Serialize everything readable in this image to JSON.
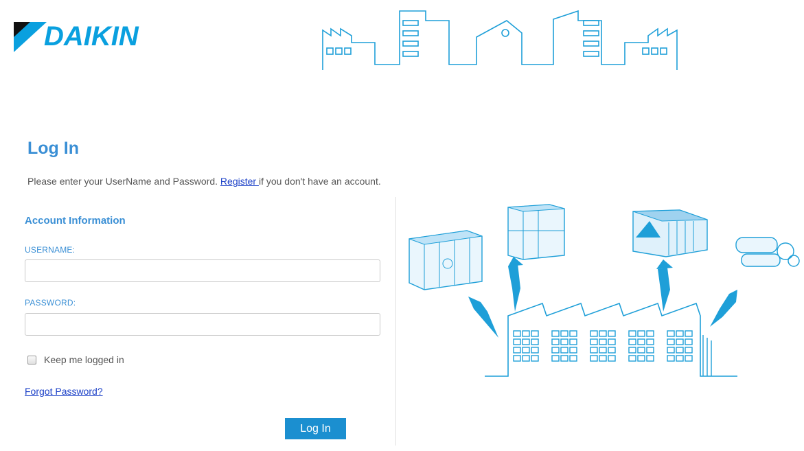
{
  "brand": {
    "name": "DAIKIN",
    "color": "#0aa0df"
  },
  "header": {
    "skyline_icon": "city-skyline-illustration"
  },
  "page": {
    "title": "Log In",
    "intro_text": "Please enter your UserName and Password. ",
    "register_link": "Register ",
    "intro_suffix": "if you don't have an account."
  },
  "form": {
    "section_title": "Account Information",
    "username_label": "USERNAME:",
    "username_value": "",
    "password_label": "PASSWORD:",
    "password_value": "",
    "remember_label": "Keep me logged in",
    "remember_checked": false,
    "forgot_link": "Forgot Password?",
    "submit_label": "Log In"
  },
  "illustration": {
    "icon": "factory-hvac-illustration"
  },
  "colors": {
    "accent": "#3a8fd5",
    "button": "#1b8fd0",
    "link": "#1a3fc7"
  }
}
